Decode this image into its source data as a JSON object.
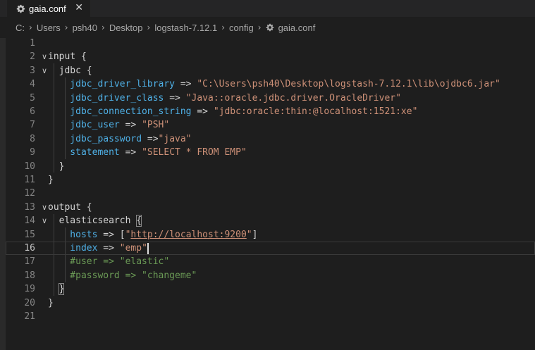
{
  "tab": {
    "label": "gaia.conf",
    "close": "✕",
    "icon": "gear-icon"
  },
  "breadcrumb": {
    "items": [
      "C:",
      "Users",
      "psh40",
      "Desktop",
      "logstash-7.12.1",
      "config"
    ],
    "file": "gaia.conf",
    "separator": "›"
  },
  "editor": {
    "current_line": 16,
    "lines": [
      {
        "num": "1",
        "tokens": []
      },
      {
        "num": "2",
        "fold": "∨",
        "tokens": [
          {
            "t": "input {",
            "c": "kw"
          }
        ]
      },
      {
        "num": "3",
        "fold": "∨",
        "tokens": [
          {
            "t": "  jdbc {",
            "c": "kw"
          }
        ]
      },
      {
        "num": "4",
        "tokens": [
          {
            "t": "    jdbc_driver_library",
            "c": "key"
          },
          {
            "t": " => ",
            "c": "op"
          },
          {
            "t": "\"C:\\Users\\psh40\\Desktop\\logstash-7.12.1\\lib\\ojdbc6.jar\"",
            "c": "str"
          }
        ]
      },
      {
        "num": "5",
        "tokens": [
          {
            "t": "    jdbc_driver_class",
            "c": "key"
          },
          {
            "t": " => ",
            "c": "op"
          },
          {
            "t": "\"Java::oracle.jdbc.driver.OracleDriver\"",
            "c": "str"
          }
        ]
      },
      {
        "num": "6",
        "tokens": [
          {
            "t": "    jdbc_connection_string",
            "c": "key"
          },
          {
            "t": " => ",
            "c": "op"
          },
          {
            "t": "\"jdbc:oracle:thin:@localhost:1521:xe\"",
            "c": "str"
          }
        ]
      },
      {
        "num": "7",
        "tokens": [
          {
            "t": "    jdbc_user",
            "c": "key"
          },
          {
            "t": " => ",
            "c": "op"
          },
          {
            "t": "\"PSH\"",
            "c": "str"
          }
        ]
      },
      {
        "num": "8",
        "tokens": [
          {
            "t": "    jdbc_password",
            "c": "key"
          },
          {
            "t": " =>",
            "c": "op"
          },
          {
            "t": "\"java\"",
            "c": "str"
          }
        ]
      },
      {
        "num": "9",
        "tokens": [
          {
            "t": "    statement",
            "c": "key"
          },
          {
            "t": " => ",
            "c": "op"
          },
          {
            "t": "\"SELECT * FROM EMP\"",
            "c": "str"
          }
        ]
      },
      {
        "num": "10",
        "tokens": [
          {
            "t": "  }",
            "c": "kw"
          }
        ]
      },
      {
        "num": "11",
        "tokens": [
          {
            "t": "}",
            "c": "kw"
          }
        ]
      },
      {
        "num": "12",
        "tokens": []
      },
      {
        "num": "13",
        "fold": "∨",
        "tokens": [
          {
            "t": "output {",
            "c": "kw"
          }
        ]
      },
      {
        "num": "14",
        "fold": "∨",
        "tokens": [
          {
            "t": "  elasticsearch {",
            "c": "kw"
          }
        ]
      },
      {
        "num": "15",
        "tokens": [
          {
            "t": "    hosts",
            "c": "key"
          },
          {
            "t": " => ",
            "c": "op"
          },
          {
            "t": "[",
            "c": "op"
          },
          {
            "t": "\"",
            "c": "str"
          },
          {
            "t": "http://localhost:9200",
            "c": "str url"
          },
          {
            "t": "\"",
            "c": "str"
          },
          {
            "t": "]",
            "c": "op"
          }
        ]
      },
      {
        "num": "16",
        "tokens": [
          {
            "t": "    index",
            "c": "key"
          },
          {
            "t": " => ",
            "c": "op"
          },
          {
            "t": "\"emp\"",
            "c": "str"
          }
        ]
      },
      {
        "num": "17",
        "tokens": [
          {
            "t": "    #user => \"elastic\"",
            "c": "cmt"
          }
        ]
      },
      {
        "num": "18",
        "tokens": [
          {
            "t": "    #password => \"changeme\"",
            "c": "cmt"
          }
        ]
      },
      {
        "num": "19",
        "tokens": [
          {
            "t": "  }",
            "c": "kw"
          }
        ]
      },
      {
        "num": "20",
        "tokens": [
          {
            "t": "}",
            "c": "kw"
          }
        ]
      },
      {
        "num": "21",
        "tokens": []
      }
    ]
  }
}
